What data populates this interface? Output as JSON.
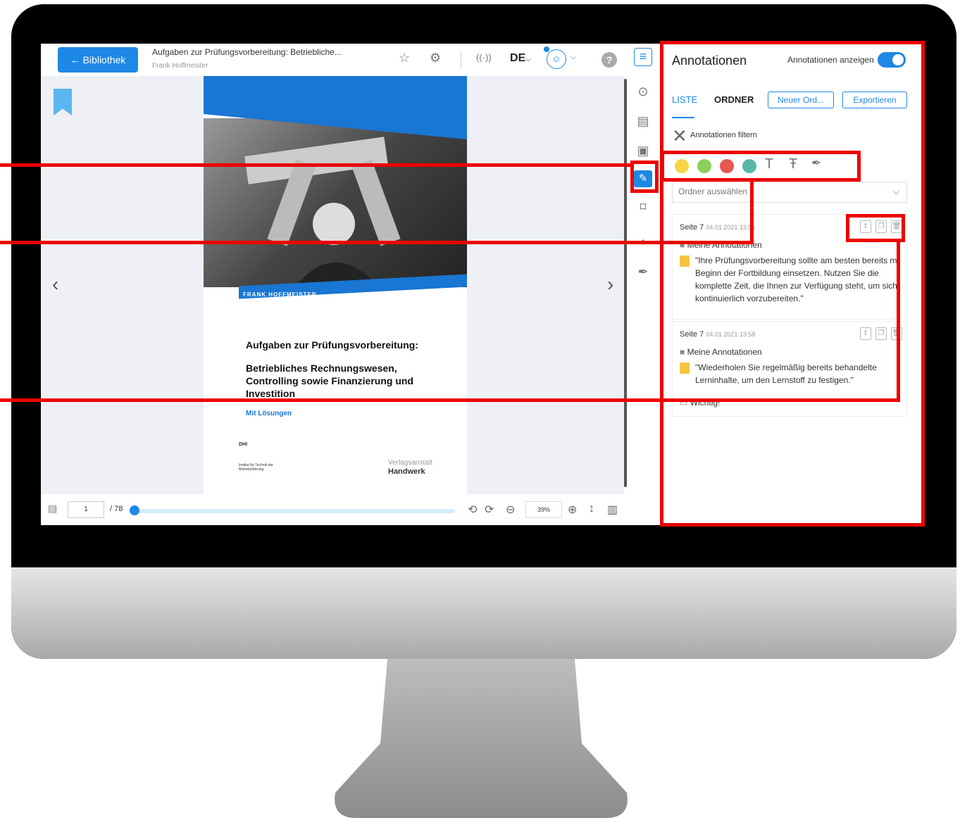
{
  "header": {
    "back_label": "← Bibliothek",
    "doc_title": "Aufgaben zur Prüfungsvorbereitung: Betriebliche...",
    "doc_author": "Frank Hoffmeister",
    "lang": "DE",
    "help": "?",
    "icons": [
      "star-icon",
      "gear-icon",
      "broadcast-icon",
      "user-icon",
      "help-icon"
    ]
  },
  "cover": {
    "author_banner": "FRANK HOFFMEISTER",
    "title": "Aufgaben zur Prüfungsvorbereitung:",
    "subtitle": "Betriebliches Rechnungswesen, Controlling sowie Finanzierung und Investition",
    "with_solutions": "Mit Lösungen",
    "institute": "Institut für Technik der Betriebsführung",
    "publisher_top": "Verlagsanstalt",
    "publisher_bottom": "Handwerk",
    "dhi": "DHI"
  },
  "pager": {
    "current_page": "1",
    "total": "/ 78",
    "zoom": "39%",
    "progress": 0.0
  },
  "panel": {
    "title": "Annotationen",
    "toggle_label": "Annotationen anzeigen",
    "toggle_on": true,
    "tab_list": "LISTE",
    "tab_folder": "ORDNER",
    "new_folder": "Neuer Ord...",
    "export": "Exportieren",
    "filter_label": "Annotationen filtern",
    "colors": [
      "#f5d547",
      "#8bcf5a",
      "#e4584e",
      "#58b8a8"
    ],
    "folder_select": "Ordner auswählen",
    "cards": [
      {
        "page": "Seite 7",
        "date": "04.01.2021 13:55",
        "folder": "Meine Annotationen",
        "quote": "\"Ihre Prüfungsvorbereitung sollte am besten bereits mi Beginn der Fortbildung einsetzen. Nutzen Sie die komplette Zeit, die Ihnen zur Verfügung steht, um sich kontinuierlich vorzubereiten.\""
      },
      {
        "page": "Seite 7",
        "date": "04.01.2021 13:58",
        "folder": "Meine Annotationen",
        "quote": "\"Wiederholen Sie regelmäßig bereits behandelte Lerninhalte, um den Lernstoff zu festigen.\"",
        "note": "Wichtig!"
      }
    ]
  },
  "accent": "#1e88e5",
  "highlight_color": "#e00000"
}
